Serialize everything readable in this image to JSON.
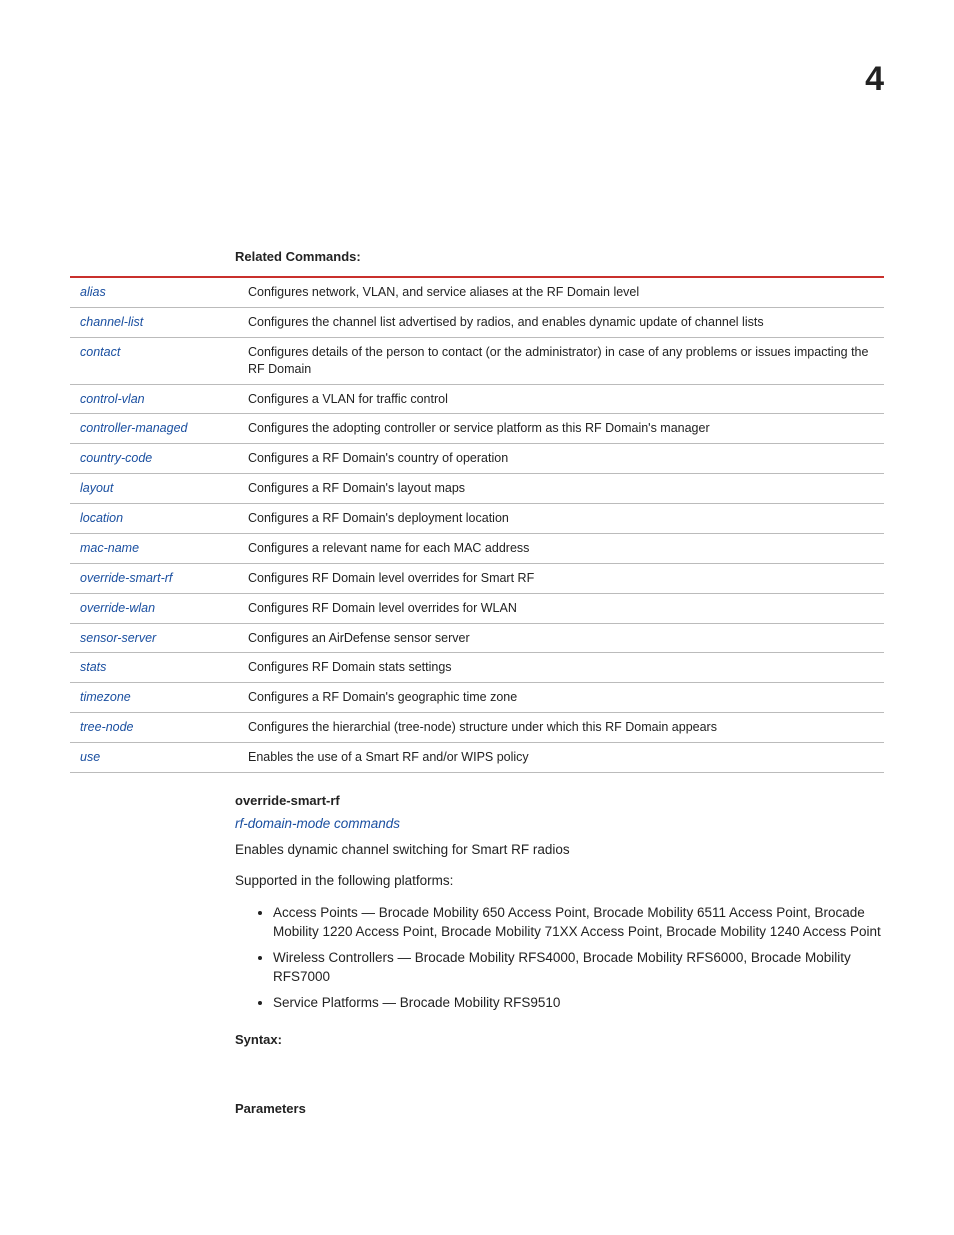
{
  "chapterNumber": "4",
  "relatedCommandsHeading": "Related Commands:",
  "commands": [
    {
      "name": "alias",
      "desc": "Configures network, VLAN, and service aliases at the RF Domain level"
    },
    {
      "name": "channel-list",
      "desc": "Configures the channel list advertised by radios, and enables dynamic update of channel lists"
    },
    {
      "name": "contact",
      "desc": "Configures details of the person to contact (or the administrator) in case of any problems or issues impacting the RF Domain"
    },
    {
      "name": "control-vlan",
      "desc": "Configures a VLAN for traffic control"
    },
    {
      "name": "controller-managed",
      "desc": "Configures the adopting controller or service platform as this RF Domain's manager"
    },
    {
      "name": "country-code",
      "desc": "Configures a RF Domain's country of operation"
    },
    {
      "name": "layout",
      "desc": "Configures a RF Domain's layout maps"
    },
    {
      "name": "location",
      "desc": "Configures a RF Domain's deployment location"
    },
    {
      "name": "mac-name",
      "desc": "Configures a relevant name for each MAC address"
    },
    {
      "name": "override-smart-rf",
      "desc": "Configures RF Domain level overrides for Smart RF"
    },
    {
      "name": "override-wlan",
      "desc": "Configures RF Domain level overrides for WLAN"
    },
    {
      "name": "sensor-server",
      "desc": "Configures an AirDefense sensor server"
    },
    {
      "name": "stats",
      "desc": "Configures RF Domain stats settings"
    },
    {
      "name": "timezone",
      "desc": "Configures a RF Domain's geographic time zone"
    },
    {
      "name": "tree-node",
      "desc": "Configures the hierarchial (tree-node) structure under which this RF Domain appears"
    },
    {
      "name": "use",
      "desc": "Enables the use of a Smart RF and/or WIPS policy"
    }
  ],
  "section": {
    "title": "override-smart-rf",
    "crossRef": "rf-domain-mode commands",
    "intro": "Enables dynamic channel switching for Smart RF radios",
    "supportedLabel": "Supported in the following platforms:",
    "platforms": [
      "Access Points — Brocade Mobility 650 Access Point, Brocade Mobility 6511 Access Point, Brocade Mobility 1220 Access Point, Brocade Mobility 71XX Access Point, Brocade Mobility 1240 Access Point",
      "Wireless Controllers — Brocade Mobility RFS4000, Brocade Mobility RFS6000, Brocade Mobility RFS7000",
      "Service Platforms — Brocade Mobility RFS9510"
    ],
    "syntaxHeading": "Syntax:",
    "parametersHeading": "Parameters"
  }
}
